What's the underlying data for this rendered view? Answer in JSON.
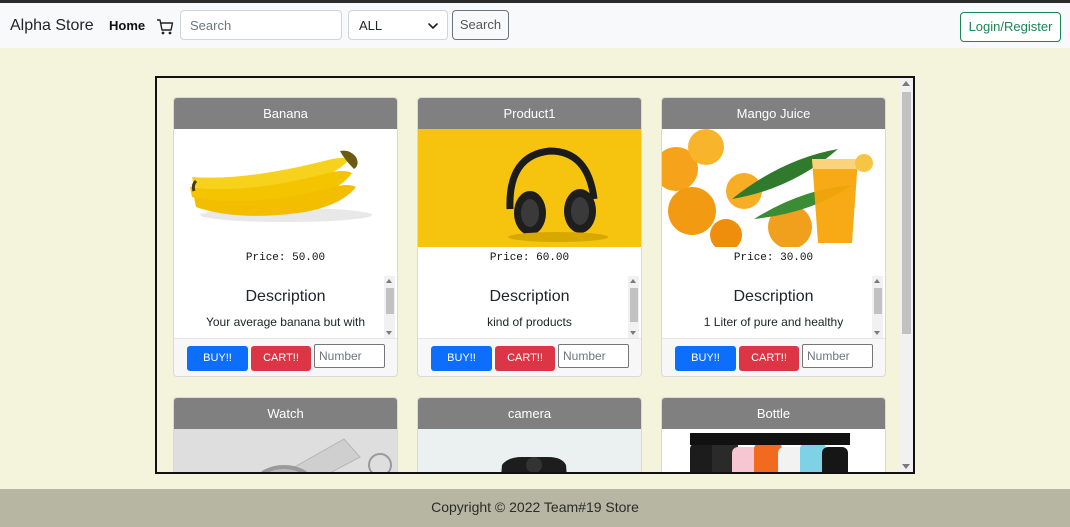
{
  "navbar": {
    "brand": "Alpha Store",
    "home_label": "Home",
    "cart_icon": "shopping-cart-icon",
    "search_placeholder": "Search",
    "category_selected": "ALL",
    "search_button": "Search",
    "login_button": "Login/Register"
  },
  "products": [
    {
      "name": "Banana",
      "price_label": "Price: 50.00",
      "desc_title": "Description",
      "desc_text": "Your average banana but with",
      "buy_label": "BUY!!",
      "cart_label": "CART!!",
      "qty_placeholder": "Number"
    },
    {
      "name": "Product1",
      "price_label": "Price: 60.00",
      "desc_title": "Description",
      "desc_text": "kind of products",
      "buy_label": "BUY!!",
      "cart_label": "CART!!",
      "qty_placeholder": "Number"
    },
    {
      "name": "Mango Juice",
      "price_label": "Price: 30.00",
      "desc_title": "Description",
      "desc_text": "1 Liter of pure and healthy",
      "buy_label": "BUY!!",
      "cart_label": "CART!!",
      "qty_placeholder": "Number"
    },
    {
      "name": "Watch"
    },
    {
      "name": "camera"
    },
    {
      "name": "Bottle"
    }
  ],
  "footer": {
    "copyright": "Copyright © 2022 Team#19 Store"
  },
  "colors": {
    "page_bg": "#f4f4dc",
    "card_header": "#808080",
    "buy": "#0d6efd",
    "cart": "#dc3545",
    "login": "#198754",
    "footer_bg": "#b6b6a2"
  }
}
